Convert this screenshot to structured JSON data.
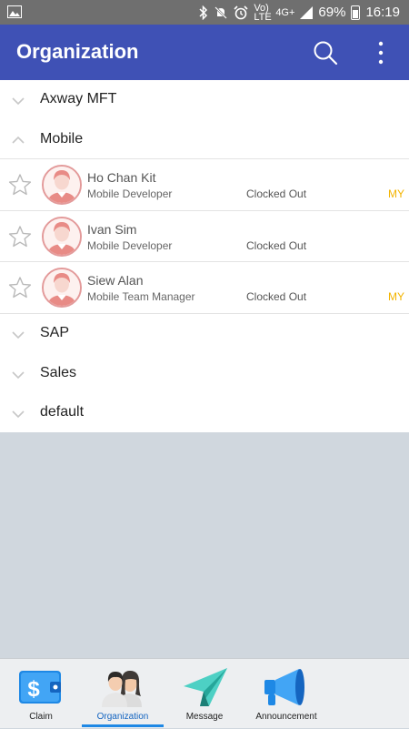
{
  "status_bar": {
    "network": "4G+",
    "network_sub": "LTE",
    "volte": "Vo) LTE",
    "battery": "69%",
    "time": "16:19"
  },
  "app_bar": {
    "title": "Organization"
  },
  "groups": [
    {
      "label": "Axway MFT",
      "expanded": false
    },
    {
      "label": "Mobile",
      "expanded": true,
      "members": [
        {
          "name": "Ho Chan Kit",
          "role": "Mobile Developer",
          "status": "Clocked Out",
          "tag": "MY"
        },
        {
          "name": "Ivan Sim",
          "role": "Mobile Developer",
          "status": "Clocked Out",
          "tag": ""
        },
        {
          "name": "Siew Alan",
          "role": "Mobile Team Manager",
          "status": "Clocked Out",
          "tag": "MY"
        }
      ]
    },
    {
      "label": "SAP",
      "expanded": false
    },
    {
      "label": "Sales",
      "expanded": false
    },
    {
      "label": "default",
      "expanded": false
    }
  ],
  "bottom_nav": {
    "tabs": [
      {
        "label": "Claim",
        "icon": "wallet-dollar-icon"
      },
      {
        "label": "Organization",
        "icon": "people-icon",
        "active": true
      },
      {
        "label": "Message",
        "icon": "paper-plane-icon"
      },
      {
        "label": "Announcement",
        "icon": "megaphone-icon"
      }
    ]
  },
  "colors": {
    "app_bar": "#3f51b5",
    "status_bar": "#6f6f6f",
    "tag": "#f3b400",
    "active_tab": "#1e88e5"
  }
}
